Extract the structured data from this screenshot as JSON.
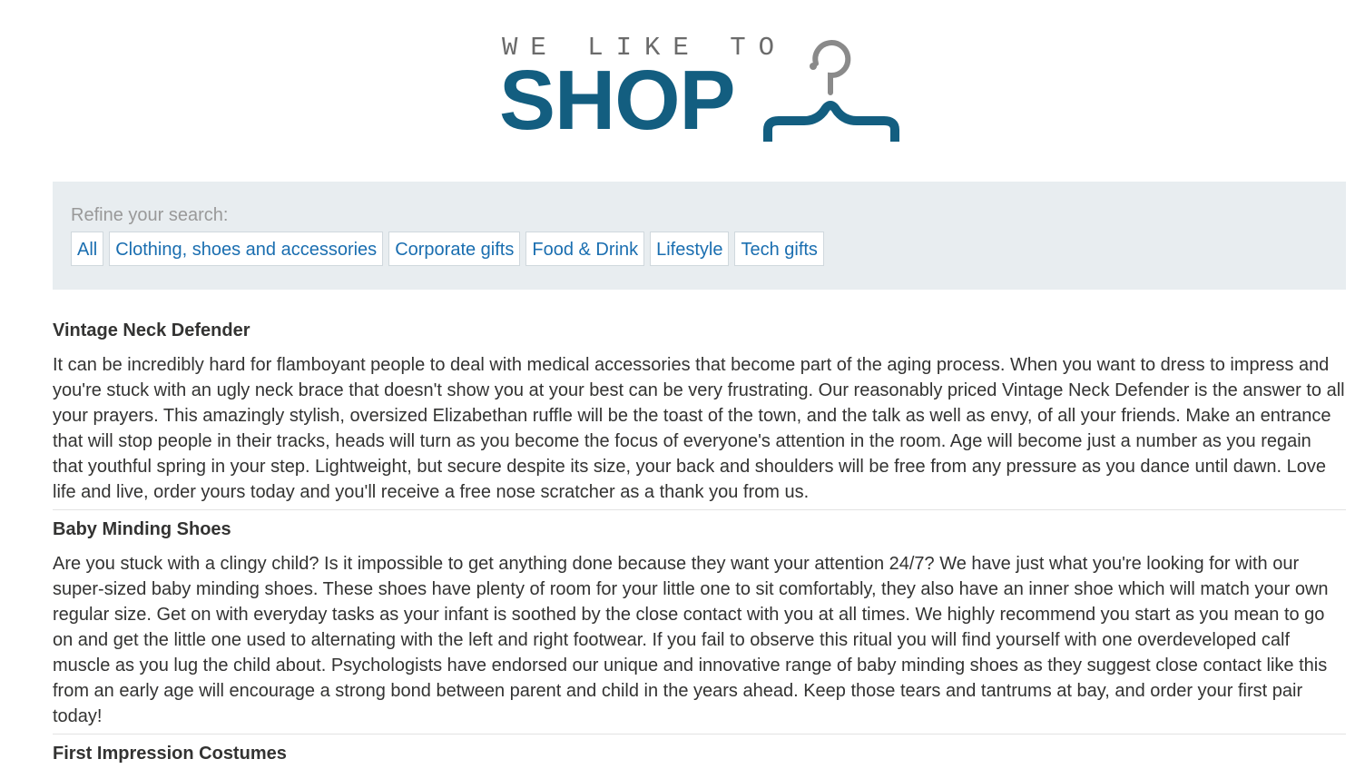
{
  "header": {
    "logo_tagline": "WE LIKE TO",
    "logo_word": "SHOP",
    "logo_icon": "hanger-icon"
  },
  "filters": {
    "title": "Refine your search:",
    "links": [
      "All",
      "Clothing, shoes and accessories",
      "Corporate gifts",
      "Food & Drink",
      "Lifestyle",
      "Tech gifts"
    ]
  },
  "products": [
    {
      "name": "Vintage Neck Defender",
      "description": "It can be incredibly hard for flamboyant people to deal with medical accessories that become part of the aging process. When you want to dress to impress and you're stuck with an ugly neck brace that doesn't show you at your best can be very frustrating. Our reasonably priced Vintage Neck Defender is the answer to all your prayers. This amazingly stylish, oversized Elizabethan ruffle will be the toast of the town, and the talk as well as envy, of all your friends. Make an entrance that will stop people in their tracks, heads will turn as you become the focus of everyone's attention in the room. Age will become just a number as you regain that youthful spring in your step. Lightweight, but secure despite its size, your back and shoulders will be free from any pressure as you dance until dawn. Love life and live, order yours today and you'll receive a free nose scratcher as a thank you from us."
    },
    {
      "name": "Baby Minding Shoes",
      "description": "Are you stuck with a clingy child? Is it impossible to get anything done because they want your attention 24/7? We have just what you're looking for with our super-sized baby minding shoes. These shoes have plenty of room for your little one to sit comfortably, they also have an inner shoe which will match your own regular size. Get on with everyday tasks as your infant is soothed by the close contact with you at all times. We highly recommend you start as you mean to go on and get the little one used to alternating with the left and right footwear. If you fail to observe this ritual you will find yourself with one overdeveloped calf muscle as you lug the child about. Psychologists have endorsed our unique and innovative range of baby minding shoes as they suggest close contact like this from an early age will encourage a strong bond between parent and child in the years ahead. Keep those tears and tantrums at bay, and order your first pair today!"
    },
    {
      "name": "First Impression Costumes",
      "description": ""
    }
  ],
  "colors": {
    "brand": "#135e80",
    "tagline": "#6b6b6b",
    "link": "#1a6eb0",
    "panel": "#e8edf0",
    "hanger_hook": "#8a8a8a"
  }
}
